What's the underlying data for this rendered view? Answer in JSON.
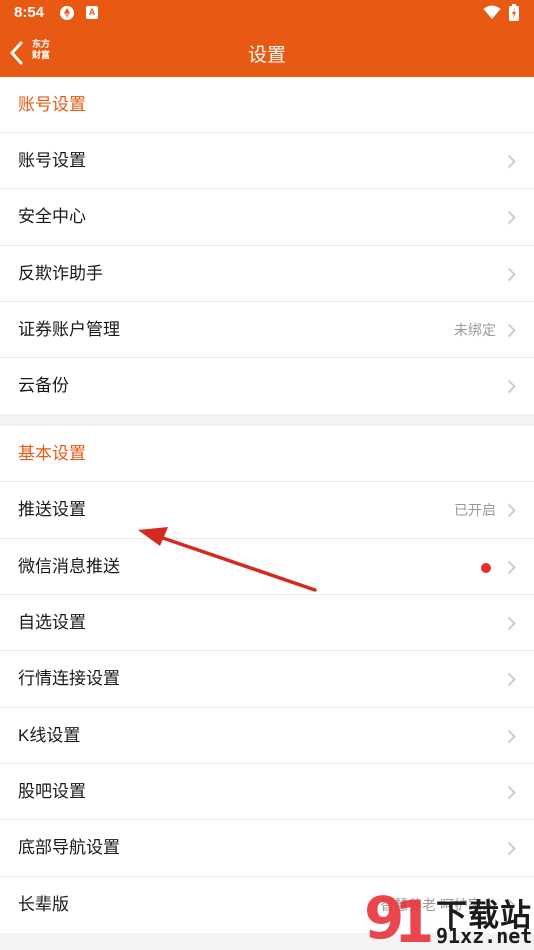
{
  "status_bar": {
    "time": "8:54",
    "notification_badge": "A"
  },
  "header": {
    "back_logo": "东方财富",
    "title": "设置"
  },
  "sections": [
    {
      "title": "账号设置",
      "items": [
        {
          "label": "账号设置",
          "value": ""
        },
        {
          "label": "安全中心",
          "value": ""
        },
        {
          "label": "反欺诈助手",
          "value": ""
        },
        {
          "label": "证券账户管理",
          "value": "未绑定"
        },
        {
          "label": "云备份",
          "value": ""
        }
      ]
    },
    {
      "title": "基本设置",
      "items": [
        {
          "label": "推送设置",
          "value": "已开启"
        },
        {
          "label": "微信消息推送",
          "value": "",
          "badge": "red-dot"
        },
        {
          "label": "自选设置",
          "value": ""
        },
        {
          "label": "行情连接设置",
          "value": ""
        },
        {
          "label": "K线设置",
          "value": ""
        },
        {
          "label": "股吧设置",
          "value": ""
        },
        {
          "label": "底部导航设置",
          "value": ""
        },
        {
          "label": "长辈版",
          "value": "智慧养老  呵护家人"
        }
      ]
    }
  ],
  "watermark": {
    "site_title": "下载站",
    "site_url": "91xz.net"
  },
  "colors": {
    "accent": "#e85a13",
    "red_dot": "#e72a2a",
    "annotation_arrow": "#d42a22"
  },
  "icons": {
    "chevron": "chevron-right-icon",
    "back": "chevron-left-icon"
  }
}
